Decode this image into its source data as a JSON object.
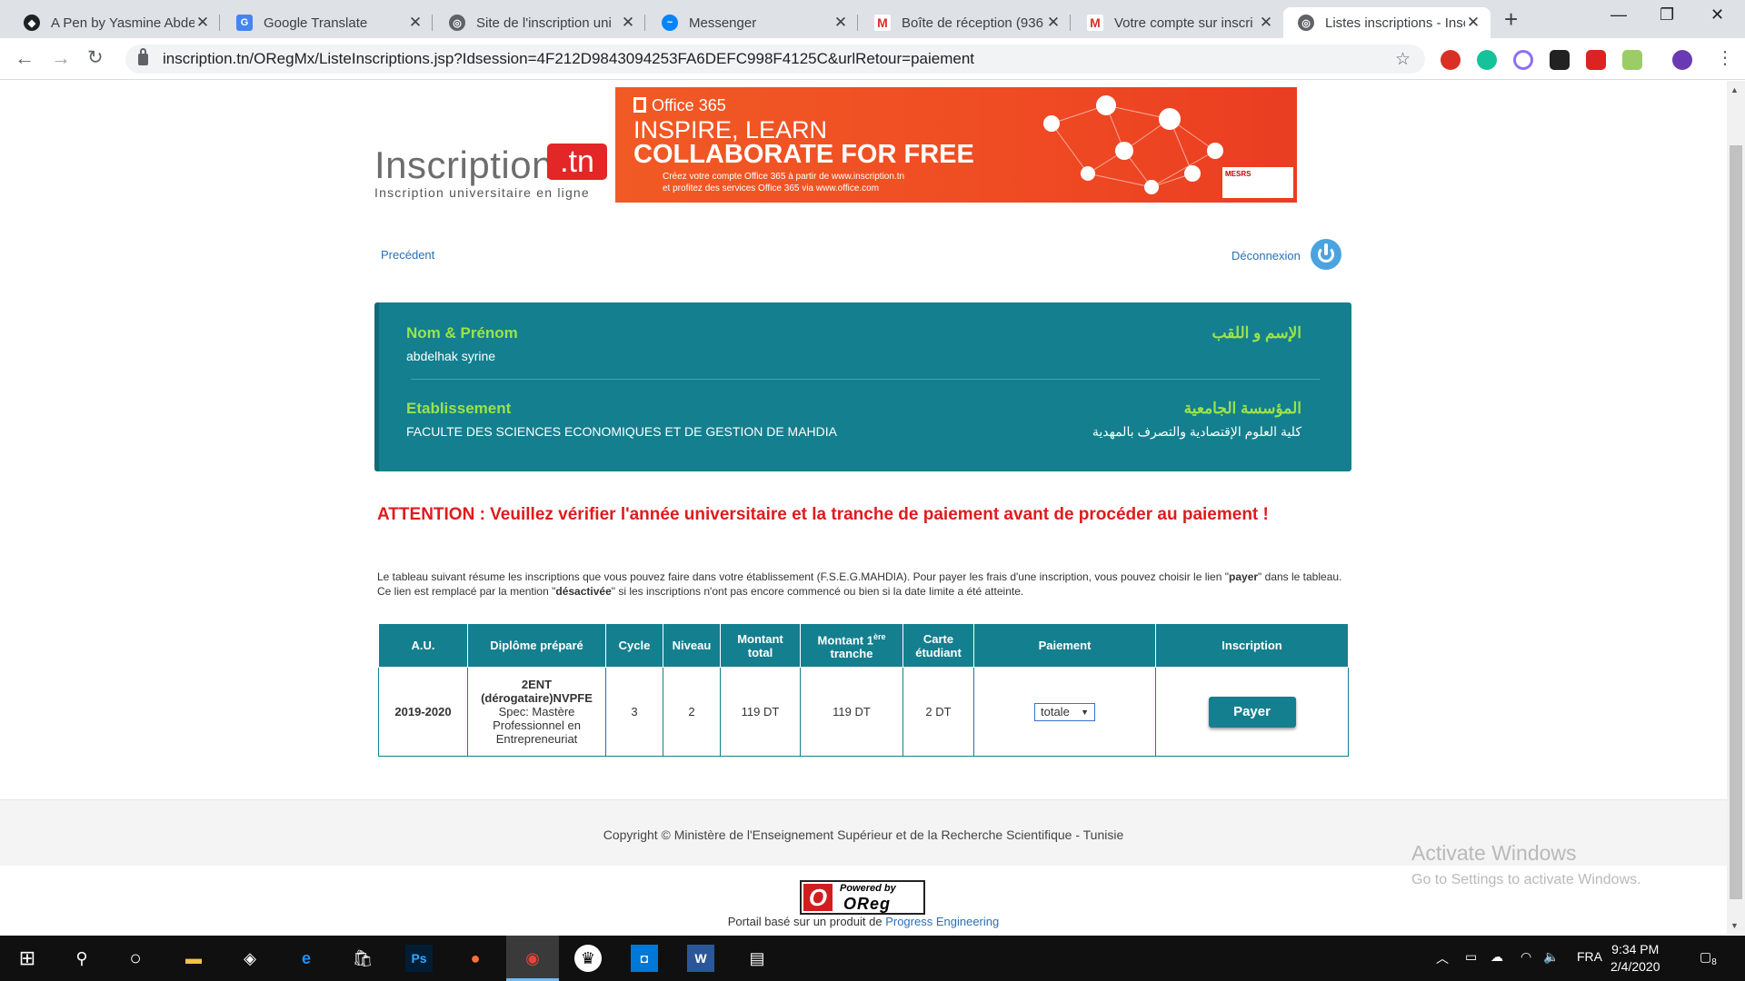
{
  "browser": {
    "tabs": [
      {
        "title": "A Pen by Yasmine Abde",
        "icon": "codepen-icon",
        "color": "#202124"
      },
      {
        "title": "Google Translate",
        "icon": "google-translate-icon",
        "color": "#4285f4"
      },
      {
        "title": "Site de l'inscription uni",
        "icon": "globe-icon",
        "color": "#5f6368"
      },
      {
        "title": "Messenger",
        "icon": "messenger-icon",
        "color": "#0084ff"
      },
      {
        "title": "Boîte de réception (936",
        "icon": "gmail-icon",
        "color": "#d93025"
      },
      {
        "title": "Votre compte sur inscri",
        "icon": "gmail-icon",
        "color": "#d93025"
      },
      {
        "title": "Listes inscriptions - Insc",
        "icon": "globe-icon",
        "color": "#5f6368"
      }
    ],
    "url": "inscription.tn/ORegMx/ListeInscriptions.jsp?Idsession=4F212D9843094253FA6DEFC998F4125C&urlRetour=paiement"
  },
  "header": {
    "logo_word": "Inscription",
    "logo_tn": ".tn",
    "logo_sub": "Inscription universitaire en ligne",
    "banner": {
      "brand": "Office 365",
      "line1": "INSPIRE, LEARN",
      "line2": "COLLABORATE FOR FREE",
      "text1": "Créez votre compte Office 365 à partir de www.inscription.tn",
      "text2": "et profitez des services Office 365 via www.office.com",
      "seal": "MESRS"
    }
  },
  "nav": {
    "prev": "Precédent",
    "logout": "Déconnexion"
  },
  "student": {
    "name_label_fr": "Nom & Prénom",
    "name_label_ar": "الإسم و اللقب",
    "name_value": "abdelhak syrine",
    "estab_label_fr": "Etablissement",
    "estab_label_ar": "المؤسسة الجامعية",
    "estab_value_fr": "FACULTE DES SCIENCES ECONOMIQUES ET DE GESTION DE MAHDIA",
    "estab_value_ar": "كلية العلوم الإقتصادية والتصرف بالمهدية"
  },
  "attention": "ATTENTION : Veuillez vérifier l'année universitaire et la tranche de paiement avant de procéder au paiement !",
  "intro": {
    "p1": "Le tableau suivant résume les inscriptions que vous pouvez faire dans votre établissement (F.S.E.G.MAHDIA). Pour payer les frais d'une inscription, vous pouvez choisir le lien \"",
    "payer": "payer",
    "p2": "\" dans le tableau. Ce lien est remplacé par la mention \"",
    "desactivee": "désactivée",
    "p3": "\" si les inscriptions n'ont pas encore commencé ou bien si la date limite a été atteinte."
  },
  "table": {
    "headers": {
      "au": "A.U.",
      "diplome": "Diplôme préparé",
      "cycle": "Cycle",
      "niveau": "Niveau",
      "montant_total": "Montant total",
      "montant_1": "Montant 1",
      "montant_1_sup": "ère",
      "montant_1_b": "tranche",
      "carte": "Carte étudiant",
      "paiement": "Paiement",
      "inscription": "Inscription"
    },
    "row": {
      "au": "2019-2020",
      "diplome_title": "2ENT (dérogataire)NVPFE",
      "diplome_spec": "Spec: Mastère Professionnel en Entrepreneuriat",
      "cycle": "3",
      "niveau": "2",
      "montant_total": "119 DT",
      "montant_1": "119 DT",
      "carte": "2 DT",
      "paiement_selected": "totale",
      "pay_button": "Payer"
    }
  },
  "footer": {
    "copyright": "Copyright © Ministère de l'Enseignement Supérieur et de la Recherche Scientifique - Tunisie",
    "powered_1": "Powered by",
    "powered_2": "OReg",
    "portal_text": "Portail basé sur un produit de ",
    "portal_link": "Progress Engineering"
  },
  "watermark": {
    "line1": "Activate Windows",
    "line2": "Go to Settings to activate Windows."
  },
  "taskbar": {
    "lang": "FRA",
    "time": "9:34 PM",
    "date": "2/4/2020",
    "notifications": "8"
  },
  "colors": {
    "teal": "#147f8e",
    "green_label": "#9be34a",
    "alert_red": "#e01b1b",
    "link_blue": "#2a6fb5"
  }
}
